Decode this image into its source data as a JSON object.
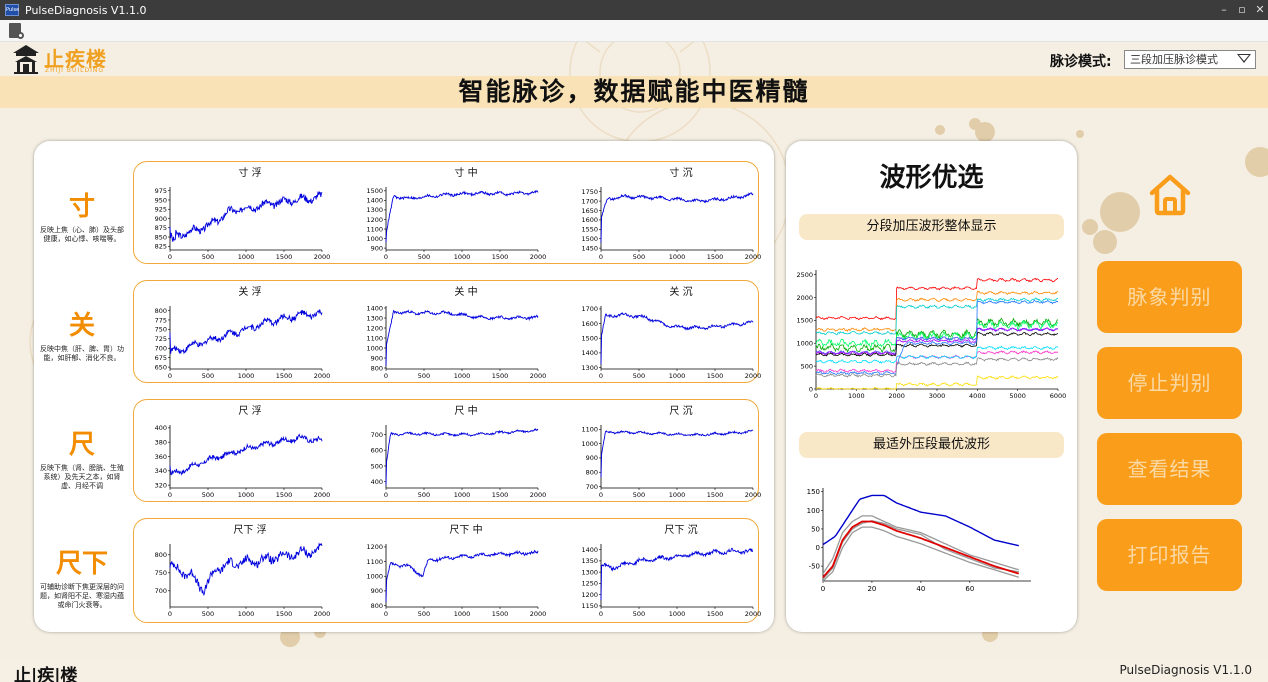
{
  "window": {
    "title": "PulseDiagnosis V1.1.0",
    "app_icon_text": "Pulse",
    "controls": [
      "–",
      "▫",
      "✕"
    ]
  },
  "toolbar": {
    "icon": "document-settings-icon"
  },
  "header": {
    "logo_name": "止疾楼",
    "logo_sub": "ZHIJI BUILDING",
    "mode_label": "脉诊模式:",
    "mode_value": "三段加压脉诊模式",
    "banner": "智能脉诊，数据赋能中医精髓"
  },
  "rows": [
    {
      "label": "寸",
      "desc": "反映上焦（心、肺）及头部健康，如心悸、咳喘等。",
      "charts": [
        {
          "title": "寸 浮",
          "yticks": [
            "975",
            "950",
            "925",
            "900",
            "875",
            "850",
            "825"
          ],
          "ymin": 815,
          "ymax": 985,
          "start": 880,
          "wave": [
            [
              0,
              850
            ],
            [
              200,
              860
            ],
            [
              500,
              880
            ],
            [
              800,
              920
            ],
            [
              1200,
              935
            ],
            [
              1600,
              950
            ],
            [
              2000,
              958
            ]
          ],
          "amp": 14,
          "drop": 830
        },
        {
          "title": "寸 中",
          "yticks": [
            "1500",
            "1400",
            "1300",
            "1200",
            "1100",
            "1000",
            "900"
          ],
          "ymin": 880,
          "ymax": 1540,
          "start": 950,
          "wave": [
            [
              0,
              1050
            ],
            [
              100,
              1440
            ],
            [
              300,
              1420
            ],
            [
              800,
              1460
            ],
            [
              1200,
              1475
            ],
            [
              1600,
              1470
            ],
            [
              2000,
              1480
            ]
          ],
          "amp": 20,
          "drop": 1400
        },
        {
          "title": "寸 沉",
          "yticks": [
            "1750",
            "1700",
            "1650",
            "1600",
            "1550",
            "1500",
            "1450"
          ],
          "ymin": 1440,
          "ymax": 1775,
          "start": 1480,
          "wave": [
            [
              0,
              1600
            ],
            [
              80,
              1710
            ],
            [
              300,
              1725
            ],
            [
              800,
              1715
            ],
            [
              1300,
              1700
            ],
            [
              1700,
              1715
            ],
            [
              2000,
              1735
            ]
          ],
          "amp": 10,
          "drop": 1700
        }
      ]
    },
    {
      "label": "关",
      "desc": "反映中焦（肝、脾、胃）功能，如肝郁、消化不良。",
      "charts": [
        {
          "title": "关 浮",
          "yticks": [
            "800",
            "775",
            "750",
            "725",
            "700",
            "675",
            "650"
          ],
          "ymin": 645,
          "ymax": 812,
          "start": 740,
          "wave": [
            [
              0,
              690
            ],
            [
              200,
              700
            ],
            [
              500,
              720
            ],
            [
              900,
              745
            ],
            [
              1300,
              770
            ],
            [
              1700,
              788
            ],
            [
              2000,
              790
            ]
          ],
          "amp": 12,
          "drop": 670
        },
        {
          "title": "关 中",
          "yticks": [
            "1400",
            "1300",
            "1200",
            "1100",
            "1000",
            "900",
            "800"
          ],
          "ymin": 790,
          "ymax": 1420,
          "start": 830,
          "wave": [
            [
              0,
              1000
            ],
            [
              100,
              1360
            ],
            [
              400,
              1350
            ],
            [
              800,
              1350
            ],
            [
              1200,
              1310
            ],
            [
              1600,
              1300
            ],
            [
              2000,
              1305
            ]
          ],
          "amp": 20,
          "drop": 1330
        },
        {
          "title": "关 沉",
          "yticks": [
            "1700",
            "1600",
            "1500",
            "1400",
            "1300"
          ],
          "ymin": 1290,
          "ymax": 1720,
          "start": 1320,
          "wave": [
            [
              0,
              1500
            ],
            [
              60,
              1650
            ],
            [
              300,
              1660
            ],
            [
              600,
              1640
            ],
            [
              900,
              1580
            ],
            [
              1300,
              1570
            ],
            [
              1700,
              1590
            ],
            [
              2000,
              1610
            ]
          ],
          "amp": 14,
          "drop": 1630
        }
      ]
    },
    {
      "label": "尺",
      "desc": "反映下焦（肾、膀胱、生殖系统）及先天之本，如肾虚、月经不调",
      "charts": [
        {
          "title": "尺 浮",
          "yticks": [
            "400",
            "380",
            "360",
            "340",
            "320"
          ],
          "ymin": 316,
          "ymax": 404,
          "start": 345,
          "wave": [
            [
              0,
              335
            ],
            [
              150,
              340
            ],
            [
              500,
              355
            ],
            [
              900,
              368
            ],
            [
              1300,
              378
            ],
            [
              1700,
              386
            ],
            [
              2000,
              382
            ]
          ],
          "amp": 5,
          "drop": 330
        },
        {
          "title": "尺 中",
          "yticks": [
            "700",
            "600",
            "500",
            "400"
          ],
          "ymin": 360,
          "ymax": 760,
          "start": 380,
          "wave": [
            [
              0,
              500
            ],
            [
              60,
              700
            ],
            [
              300,
              705
            ],
            [
              800,
              700
            ],
            [
              1200,
              700
            ],
            [
              1600,
              715
            ],
            [
              2000,
              725
            ]
          ],
          "amp": 10,
          "drop": 700
        },
        {
          "title": "尺 沉",
          "yticks": [
            "1100",
            "1000",
            "900",
            "800",
            "700"
          ],
          "ymin": 690,
          "ymax": 1130,
          "start": 760,
          "wave": [
            [
              0,
              900
            ],
            [
              60,
              1080
            ],
            [
              300,
              1080
            ],
            [
              800,
              1070
            ],
            [
              1200,
              1060
            ],
            [
              1600,
              1070
            ],
            [
              2000,
              1085
            ]
          ],
          "amp": 10,
          "drop": 1070
        }
      ]
    },
    {
      "label": "尺下",
      "desc": "可辅助诊断下焦更深层的问题，如肾阳不足、寒湿内蕴或命门火衰等。",
      "charts": [
        {
          "title": "尺下 浮",
          "yticks": [
            "800",
            "750",
            "700"
          ],
          "ymin": 655,
          "ymax": 830,
          "start": 770,
          "wave": [
            [
              0,
              770
            ],
            [
              300,
              740
            ],
            [
              450,
              700
            ],
            [
              600,
              760
            ],
            [
              800,
              775
            ],
            [
              1200,
              785
            ],
            [
              1600,
              800
            ],
            [
              2000,
              815
            ]
          ],
          "amp": 18,
          "drop": 720
        },
        {
          "title": "尺下 中",
          "yticks": [
            "1200",
            "1100",
            "1000",
            "900",
            "800"
          ],
          "ymin": 790,
          "ymax": 1220,
          "start": 820,
          "wave": [
            [
              0,
              950
            ],
            [
              60,
              1080
            ],
            [
              300,
              1070
            ],
            [
              480,
              1000
            ],
            [
              560,
              1110
            ],
            [
              900,
              1130
            ],
            [
              1400,
              1150
            ],
            [
              2000,
              1160
            ]
          ],
          "amp": 15,
          "drop": 1060
        },
        {
          "title": "尺下 沉",
          "yticks": [
            "1400",
            "1350",
            "1300",
            "1250",
            "1200",
            "1150"
          ],
          "ymin": 1145,
          "ymax": 1425,
          "start": 1180,
          "wave": [
            [
              0,
              1330
            ],
            [
              150,
              1320
            ],
            [
              500,
              1350
            ],
            [
              1000,
              1370
            ],
            [
              1400,
              1385
            ],
            [
              1800,
              1395
            ],
            [
              2000,
              1390
            ]
          ],
          "amp": 12,
          "drop": 1200
        }
      ]
    }
  ],
  "x_ticks": [
    "0",
    "500",
    "1000",
    "1500",
    "2000"
  ],
  "panel": {
    "title": "波形优选",
    "pill1": "分段加压波形整体显示",
    "pill2": "最适外压段最优波形"
  },
  "overall_chart": {
    "yticks": [
      "2500",
      "2000",
      "1500",
      "1000",
      "500",
      "0"
    ],
    "xticks": [
      "0",
      "1000",
      "2000",
      "3000",
      "4000",
      "5000",
      "6000"
    ],
    "series": [
      {
        "color": "#ff0000",
        "levels": [
          1550,
          2200,
          2380
        ]
      },
      {
        "color": "#ff8800",
        "levels": [
          1300,
          1950,
          2100
        ]
      },
      {
        "color": "#00cccc",
        "levels": [
          1220,
          1800,
          1950
        ]
      },
      {
        "color": "#00aa00",
        "levels": [
          900,
          1200,
          1450
        ]
      },
      {
        "color": "#00ff66",
        "levels": [
          1000,
          1150,
          1400
        ]
      },
      {
        "color": "#4444ff",
        "levels": [
          800,
          1100,
          1300
        ]
      },
      {
        "color": "#aa00ff",
        "levels": [
          780,
          1050,
          1300
        ]
      },
      {
        "color": "#000000",
        "levels": [
          750,
          950,
          1200
        ]
      },
      {
        "color": "#2277ff",
        "levels": [
          350,
          1000,
          1900
        ]
      },
      {
        "color": "#ff33cc",
        "levels": [
          400,
          700,
          800
        ]
      },
      {
        "color": "#888888",
        "levels": [
          300,
          550,
          650
        ]
      },
      {
        "color": "#00ddff",
        "levels": [
          600,
          700,
          900
        ]
      },
      {
        "color": "#ffdd00",
        "levels": [
          0,
          100,
          250
        ]
      }
    ]
  },
  "optimal_chart": {
    "yticks": [
      "150",
      "100",
      "50",
      "0",
      "-50"
    ],
    "xticks": [
      "0",
      "20",
      "40",
      "60"
    ],
    "blue": [
      [
        0,
        8
      ],
      [
        5,
        30
      ],
      [
        10,
        80
      ],
      [
        15,
        130
      ],
      [
        20,
        140
      ],
      [
        25,
        140
      ],
      [
        30,
        120
      ],
      [
        40,
        95
      ],
      [
        50,
        85
      ],
      [
        60,
        55
      ],
      [
        70,
        20
      ],
      [
        80,
        5
      ]
    ],
    "red": [
      [
        0,
        -80
      ],
      [
        4,
        -50
      ],
      [
        8,
        20
      ],
      [
        12,
        55
      ],
      [
        16,
        70
      ],
      [
        20,
        70
      ],
      [
        25,
        60
      ],
      [
        30,
        45
      ],
      [
        40,
        25
      ],
      [
        50,
        0
      ],
      [
        60,
        -25
      ],
      [
        70,
        -50
      ],
      [
        80,
        -70
      ]
    ],
    "grays": [
      [
        [
          0,
          -70
        ],
        [
          4,
          -30
        ],
        [
          8,
          40
        ],
        [
          12,
          70
        ],
        [
          16,
          85
        ],
        [
          20,
          85
        ],
        [
          25,
          70
        ],
        [
          30,
          55
        ],
        [
          40,
          40
        ],
        [
          50,
          10
        ],
        [
          60,
          -20
        ],
        [
          70,
          -40
        ],
        [
          80,
          -60
        ]
      ],
      [
        [
          0,
          -90
        ],
        [
          4,
          -65
        ],
        [
          8,
          0
        ],
        [
          12,
          40
        ],
        [
          16,
          55
        ],
        [
          20,
          55
        ],
        [
          25,
          45
        ],
        [
          30,
          30
        ],
        [
          40,
          10
        ],
        [
          50,
          -15
        ],
        [
          60,
          -40
        ],
        [
          70,
          -60
        ],
        [
          80,
          -80
        ]
      ],
      [
        [
          0,
          -85
        ],
        [
          4,
          -55
        ],
        [
          8,
          15
        ],
        [
          12,
          50
        ],
        [
          16,
          65
        ],
        [
          20,
          72
        ],
        [
          25,
          65
        ],
        [
          30,
          50
        ],
        [
          40,
          35
        ],
        [
          50,
          -5
        ],
        [
          60,
          -30
        ],
        [
          70,
          -55
        ],
        [
          80,
          -65
        ]
      ]
    ]
  },
  "actions": [
    "脉象判别",
    "停止判别",
    "查看结果",
    "打印报告"
  ],
  "footer": {
    "logo": "止|疾|楼",
    "version": "PulseDiagnosis V1.1.0"
  },
  "colors": {
    "accent": "#f99d1a",
    "banner": "#f9e2b5",
    "wave": "#0000dd"
  }
}
